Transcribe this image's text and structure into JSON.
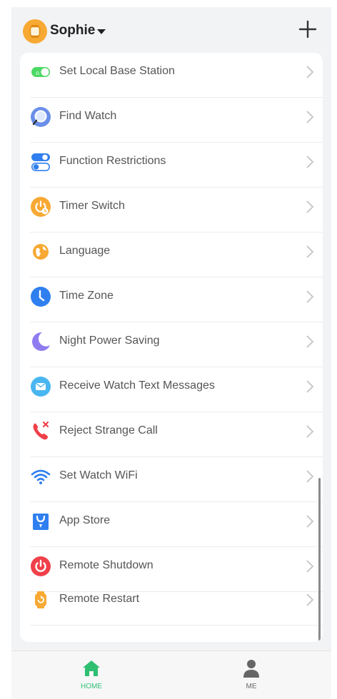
{
  "header": {
    "profile_name": "Sophie",
    "add_icon": "plus-icon"
  },
  "menu": {
    "items": [
      {
        "label": "Set Local Base Station",
        "icon": "toggle-switch-icon",
        "color": "#4cd964"
      },
      {
        "label": "Find Watch",
        "icon": "magnifier-icon",
        "color": "#5b8def"
      },
      {
        "label": "Function Restrictions",
        "icon": "toggles-icon",
        "color": "#2f7ff0"
      },
      {
        "label": "Timer Switch",
        "icon": "power-timer-icon",
        "color": "#f7a933"
      },
      {
        "label": "Language",
        "icon": "globe-icon",
        "color": "#f7a933"
      },
      {
        "label": "Time Zone",
        "icon": "clock-icon",
        "color": "#2f7ff0"
      },
      {
        "label": "Night Power Saving",
        "icon": "moon-icon",
        "color": "#8f7cf0"
      },
      {
        "label": "Receive Watch Text Messages",
        "icon": "message-icon",
        "color": "#49b6f0"
      },
      {
        "label": "Reject Strange Call",
        "icon": "phone-reject-icon",
        "color": "#f0404a"
      },
      {
        "label": "Set Watch WiFi",
        "icon": "wifi-icon",
        "color": "#2f7ff0"
      },
      {
        "label": "App Store",
        "icon": "shopping-bag-icon",
        "color": "#2f7ff0"
      },
      {
        "label": "Remote Shutdown",
        "icon": "power-icon",
        "color": "#f0404a"
      },
      {
        "label": "Remote Restart",
        "icon": "watch-restart-icon",
        "color": "#f7a933"
      }
    ]
  },
  "tabbar": {
    "home_label": "HOME",
    "me_label": "ME",
    "active_color": "#2fbf71",
    "inactive_color": "#666666"
  }
}
